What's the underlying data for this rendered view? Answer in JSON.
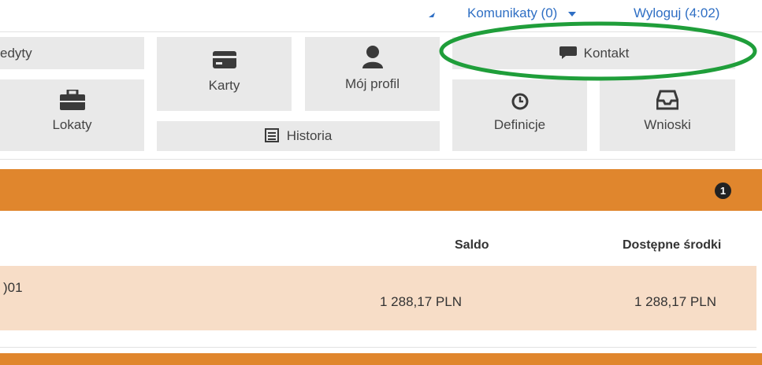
{
  "topbar": {
    "messages_label": "Komunikaty (0)",
    "logout_label": "Wyloguj (4:02)"
  },
  "tiles": {
    "kredyty": "edyty",
    "karty": "Karty",
    "profil": "Mój profil",
    "kontakt": "Kontakt",
    "lokaty": "Lokaty",
    "historia": "Historia",
    "definicje": "Definicje",
    "wnioski": "Wnioski"
  },
  "panel": {
    "badge": "1"
  },
  "table": {
    "columns": [
      "Saldo",
      "Dostępne środki"
    ],
    "rows": [
      {
        "account": ")01",
        "saldo": "1 288,17 PLN",
        "dostepne": "1 288,17 PLN"
      }
    ]
  },
  "colors": {
    "accent_orange": "#e0862d",
    "link_blue": "#2f6fc4",
    "highlight_green": "#1f9e3a",
    "tile_bg": "#e9e9e9",
    "row_bg": "#f7ddc7"
  },
  "icons": {
    "messages": "dropdown-caret-icon",
    "karty": "credit-card-icon",
    "profil": "user-icon",
    "kontakt": "chat-bubble-icon",
    "lokaty": "briefcase-icon",
    "historia": "list-document-icon",
    "definicje": "clock-icon",
    "wnioski": "inbox-tray-icon",
    "badge": "count-badge"
  }
}
